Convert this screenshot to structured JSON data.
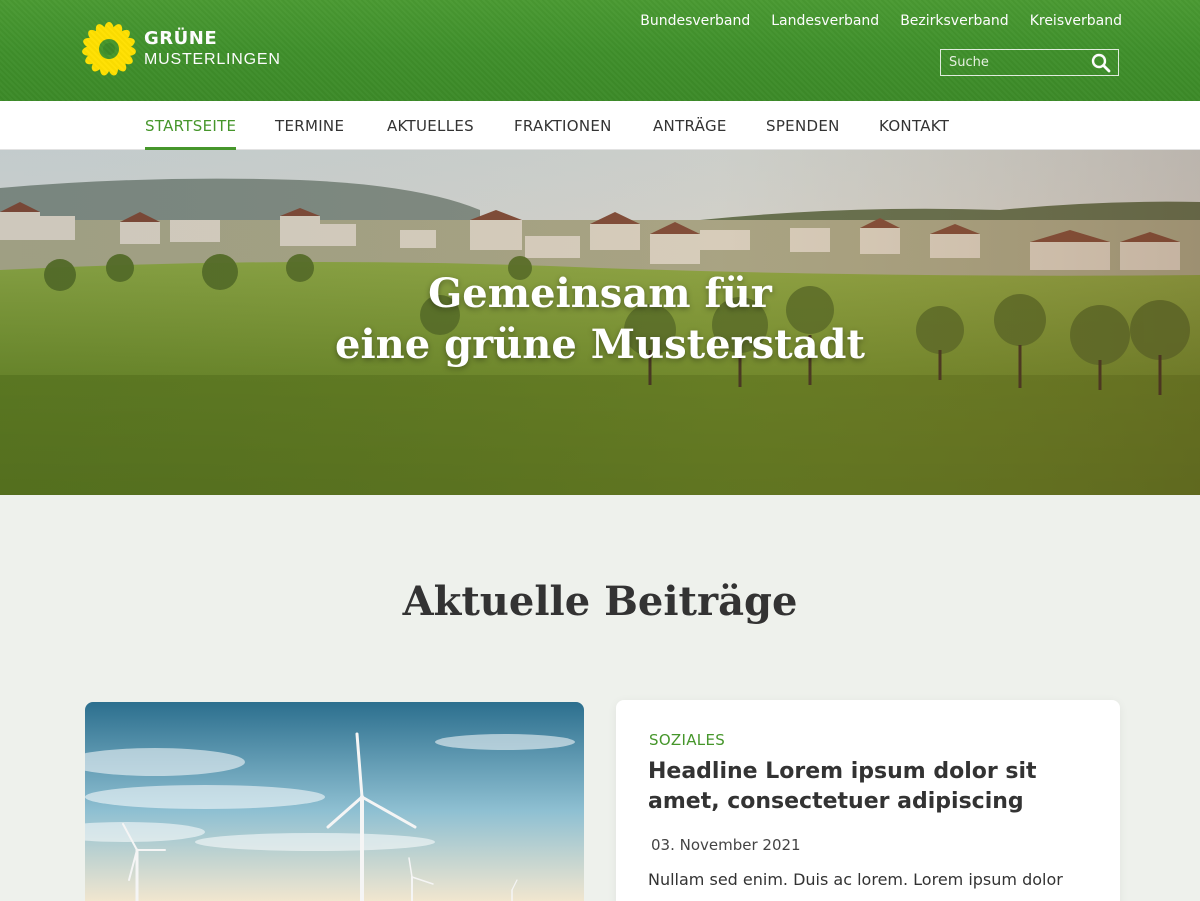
{
  "header": {
    "logo_line1": "GRÜNE",
    "logo_line2": "MUSTERLINGEN",
    "top_links": [
      "Bundesverband",
      "Landesverband",
      "Bezirksverband",
      "Kreisverband"
    ],
    "search_placeholder": "Suche"
  },
  "nav": {
    "items": [
      {
        "label": "STARTSEITE",
        "active": true
      },
      {
        "label": "TERMINE",
        "active": false
      },
      {
        "label": "AKTUELLES",
        "active": false
      },
      {
        "label": "FRAKTIONEN",
        "active": false
      },
      {
        "label": "ANTRÄGE",
        "active": false
      },
      {
        "label": "SPENDEN",
        "active": false
      },
      {
        "label": "KONTAKT",
        "active": false
      }
    ]
  },
  "hero": {
    "title_line1": "Gemeinsam für",
    "title_line2": "eine grüne Musterstadt"
  },
  "section": {
    "title": "Aktuelle Beiträge"
  },
  "post": {
    "category": "SOZIALES",
    "headline": "Headline Lorem ipsum dolor sit amet, consectetuer adipiscing",
    "date": "03. November 2021",
    "excerpt": "Nullam sed enim. Duis ac lorem. Lorem ipsum dolor"
  },
  "colors": {
    "brand_green": "#46962b",
    "sunflower_yellow": "#ffe000",
    "page_bg": "#eef1ec"
  }
}
